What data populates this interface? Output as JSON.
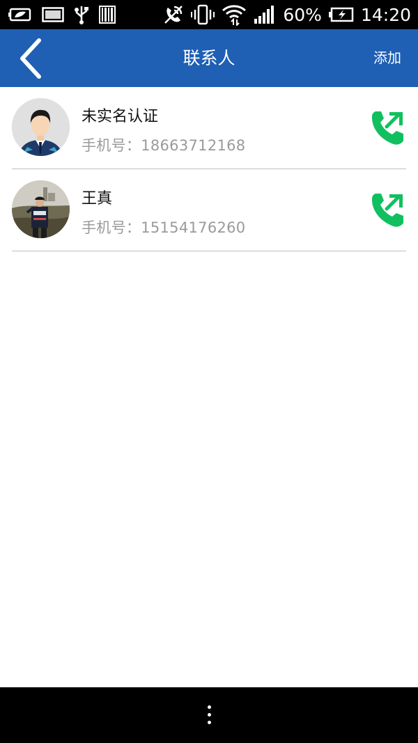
{
  "status_bar": {
    "battery": "60%",
    "time": "14:20",
    "left_icons": [
      "battery-saver-icon",
      "image-icon",
      "usb-icon",
      "barcode-icon"
    ],
    "right_icons": [
      "no-call-icon",
      "vibrate-icon",
      "wifi-icon",
      "signal-icon",
      "charging-battery-icon"
    ]
  },
  "header": {
    "title": "联系人",
    "add_label": "添加",
    "back_icon": "chevron-left-icon",
    "background": "#1f5fb4"
  },
  "contacts": [
    {
      "name": "未实名认证",
      "phone_label": "手机号：",
      "phone": "18663712168",
      "avatar": "default-person-avatar"
    },
    {
      "name": "王真",
      "phone_label": "手机号：",
      "phone": "15154176260",
      "avatar": "photo-avatar"
    }
  ],
  "call_icon_color": "#10c060",
  "nav_bar": {
    "menu_icon": "overflow-menu-icon"
  }
}
